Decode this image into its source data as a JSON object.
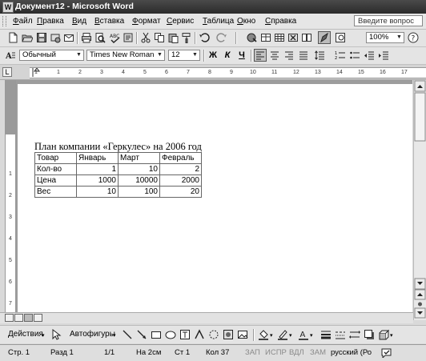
{
  "window": {
    "title": "Документ12 - Microsoft Word",
    "icon": "word-app-icon"
  },
  "menu": {
    "items": [
      "Файл",
      "Правка",
      "Вид",
      "Вставка",
      "Формат",
      "Сервис",
      "Таблица",
      "Окно",
      "Справка"
    ],
    "help_placeholder": "Введите вопрос"
  },
  "standard_toolbar": {
    "zoom": "100%"
  },
  "formatting_toolbar": {
    "style": "Обычный",
    "font": "Times New Roman",
    "size": "12",
    "bold": "Ж",
    "italic": "К",
    "underline": "Ч"
  },
  "ruler": {
    "tab_selector": "L",
    "numbers": [
      "1",
      "1",
      "2",
      "3",
      "4",
      "5",
      "6",
      "7",
      "8",
      "9",
      "10",
      "11",
      "12",
      "13",
      "14",
      "15",
      "16",
      "17"
    ]
  },
  "vertical_ruler": {
    "numbers": [
      "1",
      "2",
      "3",
      "4",
      "5",
      "6",
      "7"
    ]
  },
  "document": {
    "heading": "План компании «Геркулес» на 2006 год",
    "table": {
      "header": [
        "Товар",
        "Январь",
        "Март",
        "Февраль"
      ],
      "rows": [
        [
          "Кол-во",
          "1",
          "10",
          "2"
        ],
        [
          "Цена",
          "1000",
          "10000",
          "2000"
        ],
        [
          "Вес",
          "10",
          "100",
          "20"
        ]
      ]
    }
  },
  "drawing_toolbar": {
    "actions": "Действия",
    "autoshapes": "Автофигуры"
  },
  "status_bar": {
    "page": "Стр. 1",
    "section": "Разд 1",
    "pages": "1/1",
    "at": "На 2см",
    "line": "Ст 1",
    "column": "Кол 37",
    "rec": "ЗАП",
    "trk": "ИСПР",
    "ext": "ВДЛ",
    "ovr": "ЗАМ",
    "language": "русский (Ро"
  }
}
